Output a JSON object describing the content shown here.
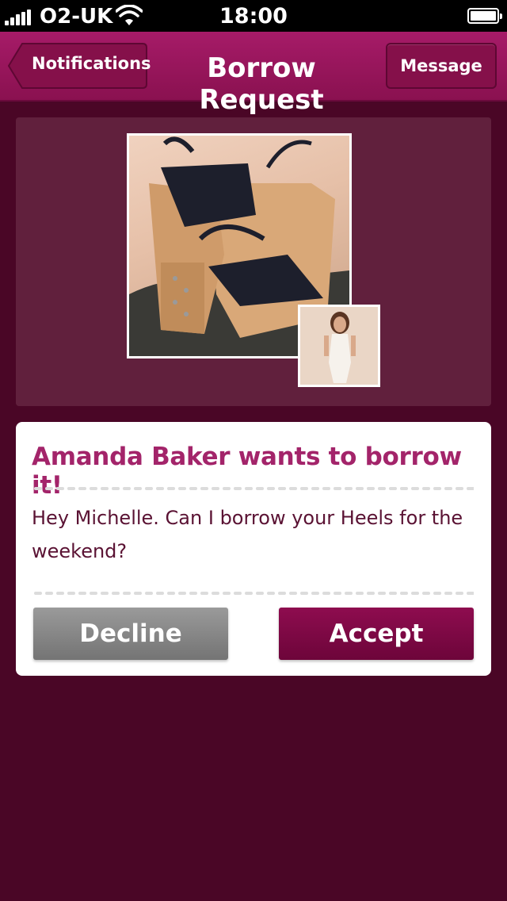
{
  "status_bar": {
    "carrier": "O2-UK",
    "time": "18:00"
  },
  "nav": {
    "back_label": "Notifications",
    "title": "Borrow Request",
    "message_label": "Message"
  },
  "photos": {
    "item_photo_icon": "shoe-photo",
    "requester_photo_icon": "avatar-photo"
  },
  "request": {
    "title": "Amanda Baker wants to borrow it!",
    "message": "Hey Michelle. Can I borrow your Heels for the weekend?",
    "decline_label": "Decline",
    "accept_label": "Accept"
  },
  "colors": {
    "background": "#4a0626",
    "nav_bar": "#9a1660",
    "accent": "#a3246a",
    "accept_button": "#7d0845",
    "decline_button": "#858585"
  }
}
